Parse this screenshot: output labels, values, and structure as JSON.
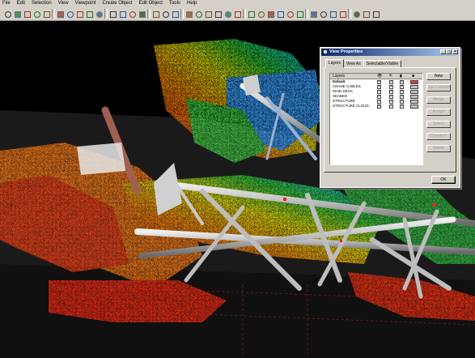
{
  "menu": [
    "File",
    "Edit",
    "Selection",
    "View",
    "Viewpoint",
    "Create Object",
    "Edit Object",
    "Tools",
    "Help"
  ],
  "toolbar_icons": [
    "select-arrow-icon",
    "select-box-icon",
    "rotate-icon",
    "hand-icon",
    "move-icon",
    "zoom-box-icon",
    "zoom-icon",
    "fit-icon",
    "pan-icon",
    "orbit-icon",
    "walk-icon",
    "text-icon",
    "vertex-icon",
    "measure-icon",
    "center-icon",
    "rotate-view-icon",
    "flip-icon",
    "cut-icon",
    "cube-icon",
    "plane-icon",
    "cylinder-icon",
    "pipe-icon",
    "torus-icon",
    "elbow-icon",
    "box-icon",
    "slab-icon",
    "beam-icon",
    "person-icon",
    "delete-icon",
    "flag-icon",
    "paint-icon",
    "layers-icon",
    "selectable-icon",
    "help-icon",
    "grid-icon",
    "settings-icon"
  ],
  "dialog": {
    "title": "View Properties",
    "tabs": [
      "Layers",
      "View As",
      "Selectable/Visible"
    ],
    "list_header": "Layers",
    "layers": [
      {
        "name": "Default",
        "bold": true,
        "color": "#cc4444"
      },
      {
        "name": "CRANE CABLES",
        "bold": false,
        "color": "#bfbfbf"
      },
      {
        "name": "MAIN DECK",
        "bold": false,
        "color": "#bfbfbf"
      },
      {
        "name": "SEABED",
        "bold": false,
        "color": "#bfbfbf"
      },
      {
        "name": "STRUCTURE",
        "bold": false,
        "color": "#bfbfbf"
      },
      {
        "name": "STRUCTURE CLOUD",
        "bold": false,
        "color": "#bfbfbf"
      }
    ],
    "buttons": {
      "new": "New",
      "set_current": "Set Current",
      "merge": "Merge",
      "assign": "Assign",
      "select": "Select",
      "deselect": "Deselect",
      "delete": "Delete"
    },
    "ok": "OK"
  }
}
